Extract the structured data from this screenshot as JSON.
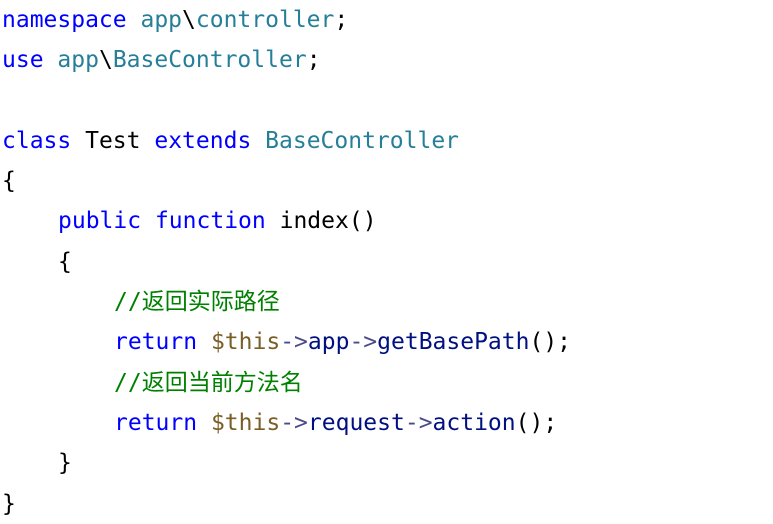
{
  "colors": {
    "keyword": "#0000ff",
    "type": "#267f99",
    "plain": "#000000",
    "variable": "#795e26",
    "property": "#001080",
    "function": "#795e26",
    "comment": "#008000",
    "operator": "#4a4a8a",
    "punct": "#000000"
  },
  "code": {
    "lines": [
      {
        "indent": 0,
        "tokens": [
          {
            "t": "namespace",
            "k": "keyword"
          },
          {
            "t": " ",
            "k": "plain"
          },
          {
            "t": "app",
            "k": "type"
          },
          {
            "t": "\\",
            "k": "plain"
          },
          {
            "t": "controller",
            "k": "type"
          },
          {
            "t": ";",
            "k": "punct"
          }
        ]
      },
      {
        "indent": 0,
        "tokens": [
          {
            "t": "use",
            "k": "keyword"
          },
          {
            "t": " ",
            "k": "plain"
          },
          {
            "t": "app",
            "k": "type"
          },
          {
            "t": "\\",
            "k": "plain"
          },
          {
            "t": "BaseController",
            "k": "type"
          },
          {
            "t": ";",
            "k": "punct"
          }
        ]
      },
      {
        "indent": 0,
        "tokens": []
      },
      {
        "indent": 0,
        "tokens": [
          {
            "t": "class",
            "k": "keyword"
          },
          {
            "t": " ",
            "k": "plain"
          },
          {
            "t": "Test",
            "k": "plain"
          },
          {
            "t": " ",
            "k": "plain"
          },
          {
            "t": "extends",
            "k": "keyword"
          },
          {
            "t": " ",
            "k": "plain"
          },
          {
            "t": "BaseController",
            "k": "type"
          }
        ]
      },
      {
        "indent": 0,
        "tokens": [
          {
            "t": "{",
            "k": "punct"
          }
        ]
      },
      {
        "indent": 1,
        "tokens": [
          {
            "t": "public",
            "k": "keyword"
          },
          {
            "t": " ",
            "k": "plain"
          },
          {
            "t": "function",
            "k": "keyword"
          },
          {
            "t": " ",
            "k": "plain"
          },
          {
            "t": "index",
            "k": "plain"
          },
          {
            "t": "()",
            "k": "punct"
          }
        ]
      },
      {
        "indent": 1,
        "tokens": [
          {
            "t": "{",
            "k": "punct"
          }
        ]
      },
      {
        "indent": 2,
        "tokens": [
          {
            "t": "//返回实际路径",
            "k": "comment"
          }
        ]
      },
      {
        "indent": 2,
        "tokens": [
          {
            "t": "return",
            "k": "keyword"
          },
          {
            "t": " ",
            "k": "plain"
          },
          {
            "t": "$this",
            "k": "variable"
          },
          {
            "t": "->",
            "k": "operator"
          },
          {
            "t": "app",
            "k": "property"
          },
          {
            "t": "->",
            "k": "operator"
          },
          {
            "t": "getBasePath",
            "k": "property"
          },
          {
            "t": "();",
            "k": "punct"
          }
        ]
      },
      {
        "indent": 2,
        "tokens": [
          {
            "t": "//返回当前方法名",
            "k": "comment"
          }
        ]
      },
      {
        "indent": 2,
        "tokens": [
          {
            "t": "return",
            "k": "keyword"
          },
          {
            "t": " ",
            "k": "plain"
          },
          {
            "t": "$this",
            "k": "variable"
          },
          {
            "t": "->",
            "k": "operator"
          },
          {
            "t": "request",
            "k": "property"
          },
          {
            "t": "->",
            "k": "operator"
          },
          {
            "t": "action",
            "k": "property"
          },
          {
            "t": "();",
            "k": "punct"
          }
        ]
      },
      {
        "indent": 1,
        "tokens": [
          {
            "t": "}",
            "k": "punct"
          }
        ]
      },
      {
        "indent": 0,
        "tokens": [
          {
            "t": "}",
            "k": "punct"
          }
        ]
      }
    ]
  }
}
